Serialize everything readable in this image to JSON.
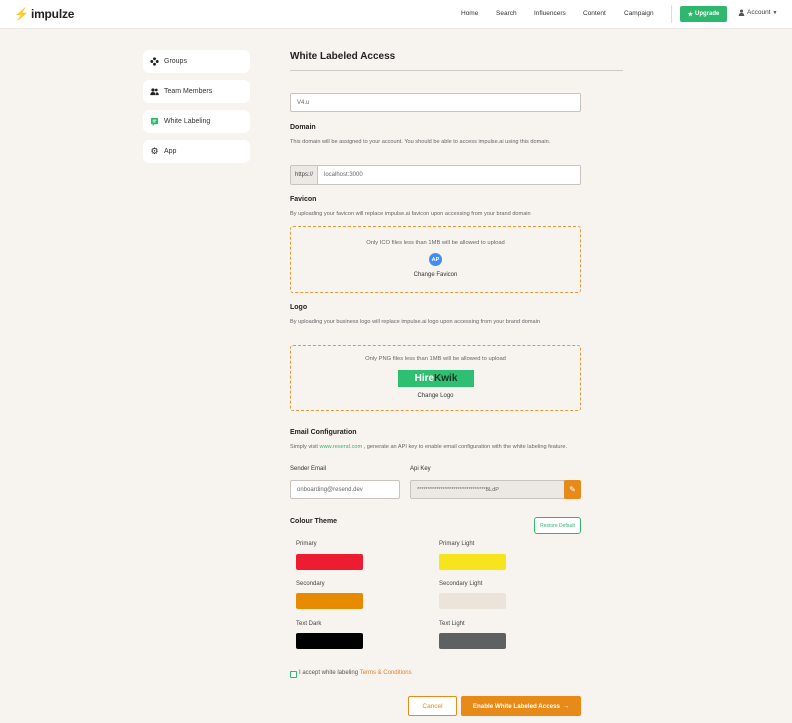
{
  "header": {
    "logo_text": "impulze",
    "nav": [
      "Home",
      "Search",
      "Influencers",
      "Content",
      "Campaign"
    ],
    "upgrade_label": "Upgrade",
    "account_label": "Account"
  },
  "sidebar": {
    "items": [
      {
        "label": "Groups",
        "icon": "groups-icon"
      },
      {
        "label": "Team Members",
        "icon": "team-members-icon"
      },
      {
        "label": "White Labeling",
        "icon": "white-labeling-icon"
      },
      {
        "label": "App",
        "icon": "gear-icon"
      }
    ]
  },
  "main": {
    "title": "White Labeled Access",
    "name_value": "V4.u",
    "domain": {
      "label": "Domain",
      "help": "This domain will be assigned to your account. You should be able to access impulse.ai using this domain.",
      "prefix": "https://",
      "value": "localhost:3000"
    },
    "favicon": {
      "label": "Favicon",
      "help": "By uploading your favicon will replace impulse.ai favicon upon accessing from your brand domain",
      "note": "Only ICO files less than 1MB will be allowed to upload",
      "icon_text": "AP",
      "change_label": "Change Favicon"
    },
    "logo": {
      "label": "Logo",
      "help": "By uploading your business logo will replace impulse.ai logo upon accessing from your brand domain",
      "note": "Only PNG files less than 1MB will be allowed to upload",
      "logo_part1": "Hire",
      "logo_part2": "Kwik",
      "change_label": "Change Logo"
    },
    "email": {
      "label": "Email Configuration",
      "help_prefix": "Simply visit",
      "help_link": "www.resend.com",
      "help_suffix": ", generate an API key to enable email configuration with the white labeling feature.",
      "sender_label": "Sender Email",
      "sender_value": "onboarding@resend.dev",
      "api_label": "Api Key",
      "api_value": "********************************BLdP"
    },
    "theme": {
      "label": "Colour Theme",
      "restore_label": "Restore Default",
      "colors": [
        {
          "label": "Primary",
          "hex": "#ed1c33"
        },
        {
          "label": "Primary Light",
          "hex": "#f6e51c"
        },
        {
          "label": "Secondary",
          "hex": "#e68a00"
        },
        {
          "label": "Secondary Light",
          "hex": "#ece3db"
        },
        {
          "label": "Text Dark",
          "hex": "#000000"
        },
        {
          "label": "Text Light",
          "hex": "#5f6062"
        }
      ]
    },
    "terms": {
      "prefix": "I accept white labeling",
      "link": "Terms & Conditions"
    },
    "cancel_label": "Cancel",
    "enable_label": "Enable White Labeled Access",
    "enable_arrow": "→"
  }
}
